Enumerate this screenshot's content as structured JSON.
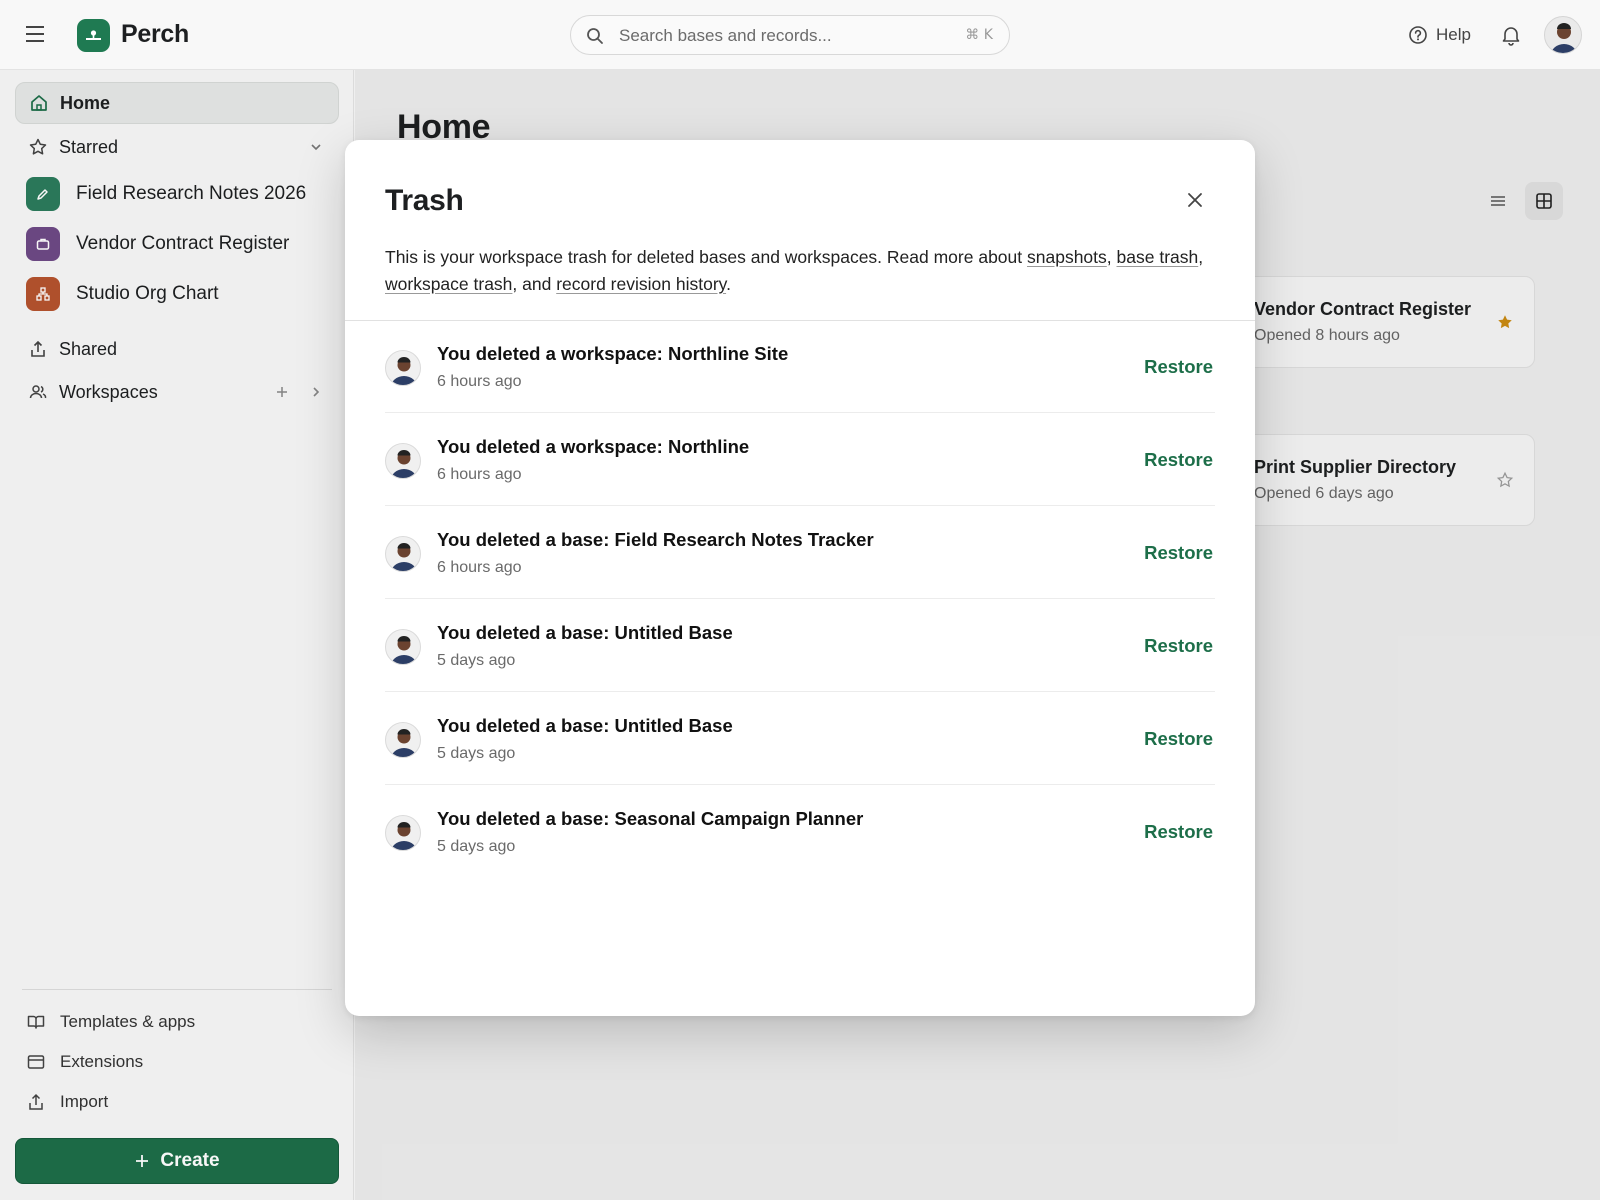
{
  "app": {
    "name": "Perch",
    "brand_color": "#1d6e49"
  },
  "search": {
    "placeholder": "Search bases and records...",
    "shortcut": "⌘ K"
  },
  "header": {
    "help_label": "Help"
  },
  "sidebar": {
    "nav": [
      {
        "label": "Home",
        "icon": "home-icon",
        "active": true
      },
      {
        "label": "Starred",
        "icon": "star-outline-icon"
      }
    ],
    "starred_bases": [
      {
        "label": "Field Research Notes 2026",
        "icon": "pencil-icon",
        "color": "#2c7b5c"
      },
      {
        "label": "Vendor Contract Register",
        "icon": "briefcase-icon",
        "color": "#6e4a86"
      },
      {
        "label": "Studio Org Chart",
        "icon": "org-chart-icon",
        "color": "#b5532e"
      }
    ],
    "shared_label": "Shared",
    "workspaces_label": "Workspaces",
    "bottom": [
      {
        "label": "Templates & apps",
        "icon": "book-icon"
      },
      {
        "label": "Extensions",
        "icon": "extensions-icon"
      },
      {
        "label": "Import",
        "icon": "upload-icon"
      }
    ],
    "create_label": "Create"
  },
  "main": {
    "title": "Home",
    "cards": [
      {
        "title": "Vendor Contract Register",
        "subtitle": "Opened 8 hours ago",
        "starred": true
      },
      {
        "title": "Print Supplier Directory",
        "subtitle": "Opened 6 days ago",
        "starred": false
      }
    ]
  },
  "modal": {
    "title": "Trash",
    "desc_intro": "This is your workspace trash for deleted bases and workspaces. Read more about ",
    "link_snapshots": "snapshots",
    "link_base_trash": "base trash",
    "link_workspace_trash": "workspace trash",
    "link_revision_history": "record revision history",
    "sep_comma": ", ",
    "sep_and": ", and ",
    "sep_end": ".",
    "restore_label": "Restore",
    "items": [
      {
        "title": "You deleted a workspace: Northline Site",
        "time": "6 hours ago"
      },
      {
        "title": "You deleted a workspace: Northline",
        "time": "6 hours ago"
      },
      {
        "title": "You deleted a base: Field Research Notes Tracker",
        "time": "6 hours ago"
      },
      {
        "title": "You deleted a base: Untitled Base",
        "time": "5 days ago"
      },
      {
        "title": "You deleted a base: Untitled Base",
        "time": "5 days ago"
      },
      {
        "title": "You deleted a base: Seasonal Campaign Planner",
        "time": "5 days ago"
      }
    ]
  }
}
